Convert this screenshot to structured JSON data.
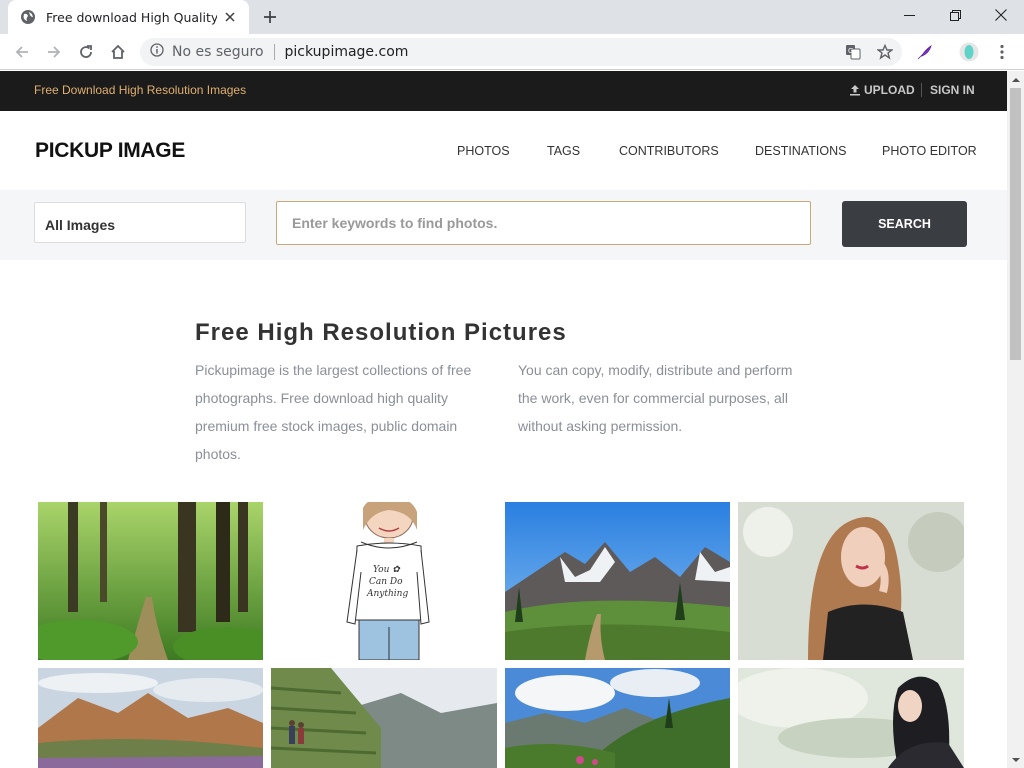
{
  "browser": {
    "tab_title": "Free download High Quality Stoc",
    "security_label": "No es seguro",
    "url": "pickupimage.com"
  },
  "site": {
    "tagline": "Free Download High Resolution Images",
    "upload_label": "UPLOAD",
    "signin_label": "SIGN IN",
    "logo": "PICKUP IMAGE",
    "nav": [
      {
        "label": "PHOTOS"
      },
      {
        "label": "TAGS"
      },
      {
        "label": "CONTRIBUTORS"
      },
      {
        "label": "DESTINATIONS"
      },
      {
        "label": "PHOTO EDITOR"
      }
    ],
    "search": {
      "category": "All Images",
      "placeholder": "Enter keywords to find photos.",
      "button": "SEARCH"
    },
    "intro": {
      "title": "Free High Resolution Pictures",
      "col1": "Pickupimage is the largest collections of free photographs. Free download high quality premium free stock images, public domain photos.",
      "col2": "You can copy, modify, distribute and perform the work, even for commercial purposes, all without asking permission."
    },
    "photos": [
      {
        "name": "forest-path-photo"
      },
      {
        "name": "girl-illustration-photo"
      },
      {
        "name": "mountain-meadow-photo"
      },
      {
        "name": "woman-portrait-photo"
      },
      {
        "name": "desert-mountains-photo"
      },
      {
        "name": "terraces-hikers-photo"
      },
      {
        "name": "alpine-clouds-photo"
      },
      {
        "name": "woman-profile-photo"
      }
    ],
    "illustration_text": "You Can Do Anything"
  }
}
